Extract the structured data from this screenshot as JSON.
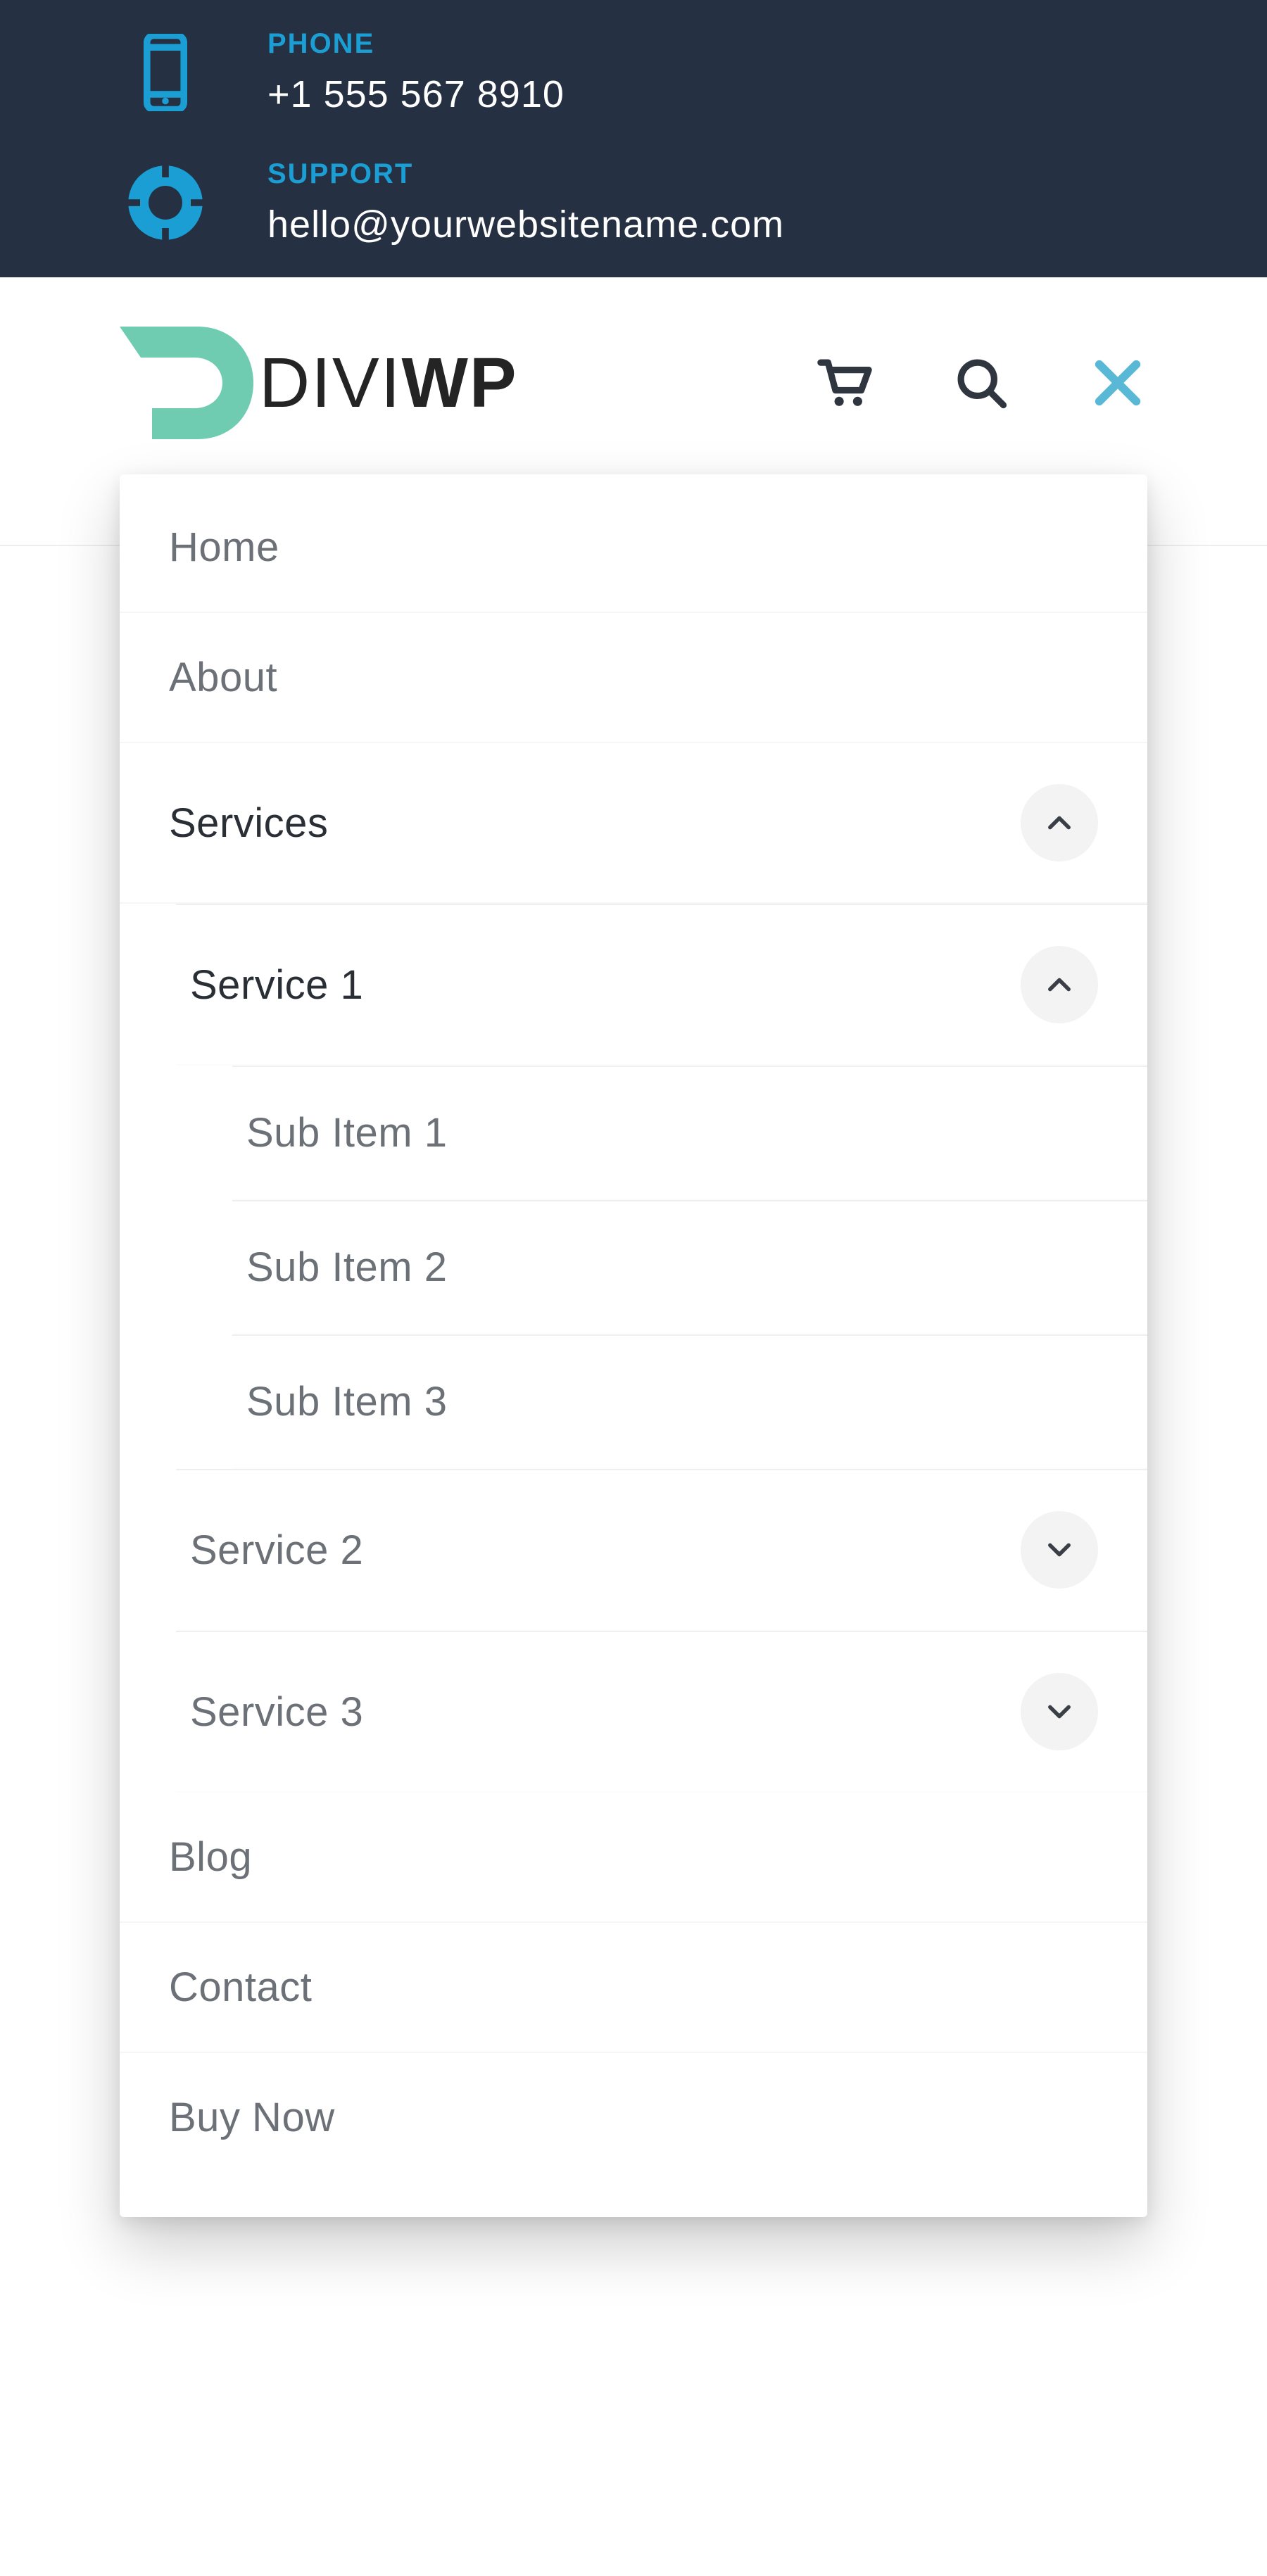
{
  "topbar": {
    "phone": {
      "label": "PHONE",
      "value": "+1 555 567 8910"
    },
    "support": {
      "label": "SUPPORT",
      "value": "hello@yourwebsitename.com"
    }
  },
  "logo": {
    "thin": "DIVI",
    "bold": "WP"
  },
  "menu": {
    "home": {
      "label": "Home"
    },
    "about": {
      "label": "About"
    },
    "services": {
      "label": "Services",
      "items": [
        {
          "label": "Service 1",
          "subitems": [
            {
              "label": "Sub Item 1"
            },
            {
              "label": "Sub Item 2"
            },
            {
              "label": "Sub Item 3"
            }
          ]
        },
        {
          "label": "Service 2"
        },
        {
          "label": "Service 3"
        }
      ]
    },
    "blog": {
      "label": "Blog"
    },
    "contact": {
      "label": "Contact"
    },
    "buynow": {
      "label": "Buy Now"
    }
  },
  "colors": {
    "accent": "#1a9ed4",
    "mint": "#6fccb1",
    "dark": "#253043",
    "ink": "#2a2f36",
    "muted": "#6c7077"
  }
}
